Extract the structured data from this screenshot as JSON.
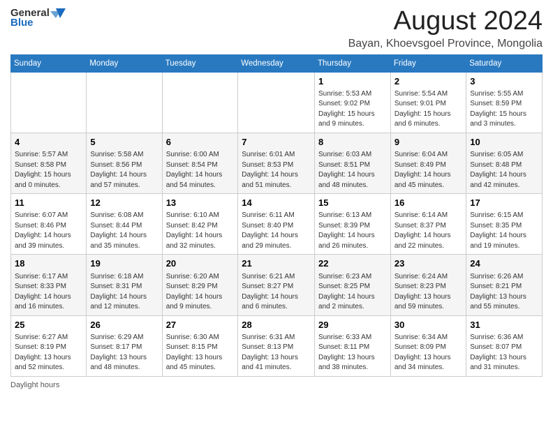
{
  "header": {
    "logo_general": "General",
    "logo_blue": "Blue",
    "month": "August 2024",
    "location": "Bayan, Khoevsgoel Province, Mongolia"
  },
  "weekdays": [
    "Sunday",
    "Monday",
    "Tuesday",
    "Wednesday",
    "Thursday",
    "Friday",
    "Saturday"
  ],
  "weeks": [
    [
      {
        "day": "",
        "info": ""
      },
      {
        "day": "",
        "info": ""
      },
      {
        "day": "",
        "info": ""
      },
      {
        "day": "",
        "info": ""
      },
      {
        "day": "1",
        "info": "Sunrise: 5:53 AM\nSunset: 9:02 PM\nDaylight: 15 hours and 9 minutes."
      },
      {
        "day": "2",
        "info": "Sunrise: 5:54 AM\nSunset: 9:01 PM\nDaylight: 15 hours and 6 minutes."
      },
      {
        "day": "3",
        "info": "Sunrise: 5:55 AM\nSunset: 8:59 PM\nDaylight: 15 hours and 3 minutes."
      }
    ],
    [
      {
        "day": "4",
        "info": "Sunrise: 5:57 AM\nSunset: 8:58 PM\nDaylight: 15 hours and 0 minutes."
      },
      {
        "day": "5",
        "info": "Sunrise: 5:58 AM\nSunset: 8:56 PM\nDaylight: 14 hours and 57 minutes."
      },
      {
        "day": "6",
        "info": "Sunrise: 6:00 AM\nSunset: 8:54 PM\nDaylight: 14 hours and 54 minutes."
      },
      {
        "day": "7",
        "info": "Sunrise: 6:01 AM\nSunset: 8:53 PM\nDaylight: 14 hours and 51 minutes."
      },
      {
        "day": "8",
        "info": "Sunrise: 6:03 AM\nSunset: 8:51 PM\nDaylight: 14 hours and 48 minutes."
      },
      {
        "day": "9",
        "info": "Sunrise: 6:04 AM\nSunset: 8:49 PM\nDaylight: 14 hours and 45 minutes."
      },
      {
        "day": "10",
        "info": "Sunrise: 6:05 AM\nSunset: 8:48 PM\nDaylight: 14 hours and 42 minutes."
      }
    ],
    [
      {
        "day": "11",
        "info": "Sunrise: 6:07 AM\nSunset: 8:46 PM\nDaylight: 14 hours and 39 minutes."
      },
      {
        "day": "12",
        "info": "Sunrise: 6:08 AM\nSunset: 8:44 PM\nDaylight: 14 hours and 35 minutes."
      },
      {
        "day": "13",
        "info": "Sunrise: 6:10 AM\nSunset: 8:42 PM\nDaylight: 14 hours and 32 minutes."
      },
      {
        "day": "14",
        "info": "Sunrise: 6:11 AM\nSunset: 8:40 PM\nDaylight: 14 hours and 29 minutes."
      },
      {
        "day": "15",
        "info": "Sunrise: 6:13 AM\nSunset: 8:39 PM\nDaylight: 14 hours and 26 minutes."
      },
      {
        "day": "16",
        "info": "Sunrise: 6:14 AM\nSunset: 8:37 PM\nDaylight: 14 hours and 22 minutes."
      },
      {
        "day": "17",
        "info": "Sunrise: 6:15 AM\nSunset: 8:35 PM\nDaylight: 14 hours and 19 minutes."
      }
    ],
    [
      {
        "day": "18",
        "info": "Sunrise: 6:17 AM\nSunset: 8:33 PM\nDaylight: 14 hours and 16 minutes."
      },
      {
        "day": "19",
        "info": "Sunrise: 6:18 AM\nSunset: 8:31 PM\nDaylight: 14 hours and 12 minutes."
      },
      {
        "day": "20",
        "info": "Sunrise: 6:20 AM\nSunset: 8:29 PM\nDaylight: 14 hours and 9 minutes."
      },
      {
        "day": "21",
        "info": "Sunrise: 6:21 AM\nSunset: 8:27 PM\nDaylight: 14 hours and 6 minutes."
      },
      {
        "day": "22",
        "info": "Sunrise: 6:23 AM\nSunset: 8:25 PM\nDaylight: 14 hours and 2 minutes."
      },
      {
        "day": "23",
        "info": "Sunrise: 6:24 AM\nSunset: 8:23 PM\nDaylight: 13 hours and 59 minutes."
      },
      {
        "day": "24",
        "info": "Sunrise: 6:26 AM\nSunset: 8:21 PM\nDaylight: 13 hours and 55 minutes."
      }
    ],
    [
      {
        "day": "25",
        "info": "Sunrise: 6:27 AM\nSunset: 8:19 PM\nDaylight: 13 hours and 52 minutes."
      },
      {
        "day": "26",
        "info": "Sunrise: 6:29 AM\nSunset: 8:17 PM\nDaylight: 13 hours and 48 minutes."
      },
      {
        "day": "27",
        "info": "Sunrise: 6:30 AM\nSunset: 8:15 PM\nDaylight: 13 hours and 45 minutes."
      },
      {
        "day": "28",
        "info": "Sunrise: 6:31 AM\nSunset: 8:13 PM\nDaylight: 13 hours and 41 minutes."
      },
      {
        "day": "29",
        "info": "Sunrise: 6:33 AM\nSunset: 8:11 PM\nDaylight: 13 hours and 38 minutes."
      },
      {
        "day": "30",
        "info": "Sunrise: 6:34 AM\nSunset: 8:09 PM\nDaylight: 13 hours and 34 minutes."
      },
      {
        "day": "31",
        "info": "Sunrise: 6:36 AM\nSunset: 8:07 PM\nDaylight: 13 hours and 31 minutes."
      }
    ]
  ],
  "footer": {
    "daylight_label": "Daylight hours"
  }
}
